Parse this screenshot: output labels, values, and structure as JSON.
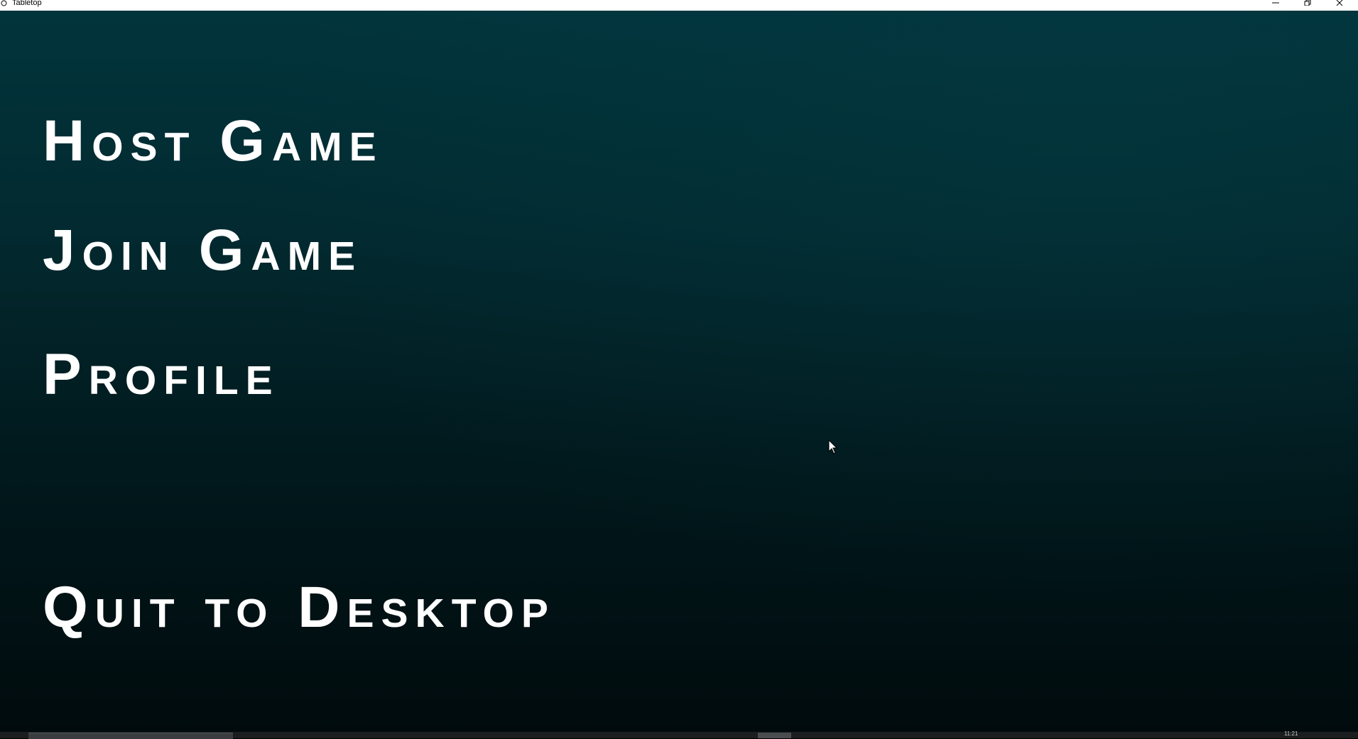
{
  "window": {
    "title": "Tabletop",
    "icon": "app-icon",
    "controls": {
      "minimize_icon": "minimize-icon",
      "maximize_icon": "restore-icon",
      "close_icon": "close-icon"
    }
  },
  "menu": {
    "items": [
      {
        "label": "Host Game"
      },
      {
        "label": "Join Game"
      },
      {
        "label": "Profile"
      },
      {
        "label": "Quit to Desktop"
      }
    ]
  },
  "colors": {
    "background_top": "#02343c",
    "background_bottom": "#010b0d",
    "text": "#ffffff"
  },
  "taskbar": {
    "clock": "11:21"
  }
}
